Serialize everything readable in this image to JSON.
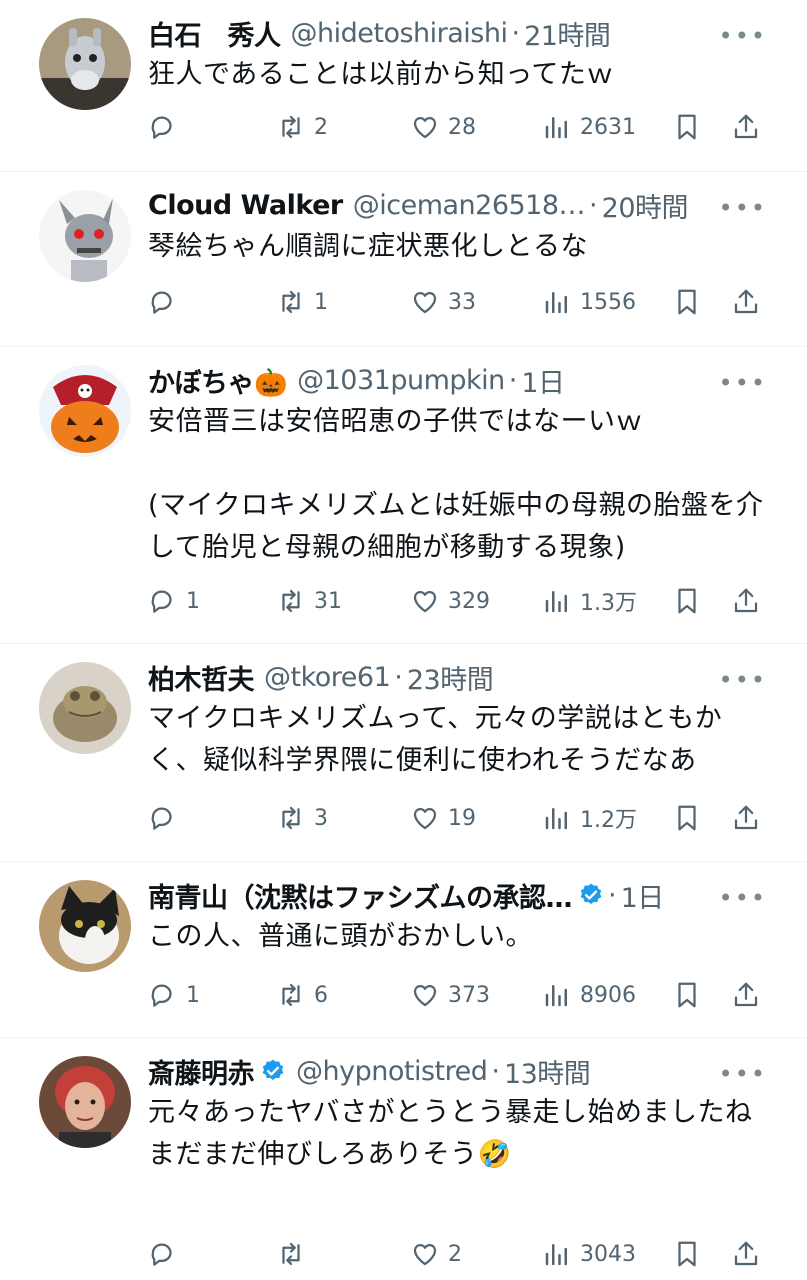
{
  "tweets": [
    {
      "name": "白石　秀人",
      "verified": false,
      "handle": "@hidetoshiraishi",
      "time": "21時間",
      "text": "狂人であることは以前から知ってたｗ",
      "replies": "",
      "retweets": "2",
      "likes": "28",
      "views": "2631",
      "avatar_icon": "donkey-robot-avatar"
    },
    {
      "name": "Cloud Walker",
      "verified": false,
      "handle": "@iceman26518…",
      "time": "20時間",
      "text": "琴絵ちゃん順調に症状悪化しとるな",
      "replies": "",
      "retweets": "1",
      "likes": "33",
      "views": "1556",
      "avatar_icon": "robot-avatar"
    },
    {
      "name": "かぼちゃ🎃",
      "verified": false,
      "handle": "@1031pumpkin",
      "time": "1日",
      "text": "安倍晋三は安倍昭恵の子供ではなーいｗ\n\n(マイクロキメリズムとは妊娠中の母親の胎盤を介して胎児と母親の細胞が移動する現象)",
      "replies": "1",
      "retweets": "31",
      "likes": "329",
      "views": "1.3万",
      "avatar_icon": "pirate-pumpkin-avatar"
    },
    {
      "name": "柏木哲夫",
      "verified": false,
      "handle": "@tkore61",
      "time": "23時間",
      "text": "マイクロキメリズムって、元々の学説はともかく、疑似科学界隈に便利に使われそうだなあ",
      "replies": "",
      "retweets": "3",
      "likes": "19",
      "views": "1.2万",
      "avatar_icon": "frog-statue-avatar"
    },
    {
      "name": "南青山（沈黙はファシズムの承認…",
      "verified": true,
      "handle": "",
      "time": "1日",
      "text": "この人、普通に頭がおかしい。",
      "replies": "1",
      "retweets": "6",
      "likes": "373",
      "views": "8906",
      "avatar_icon": "cat-avatar"
    },
    {
      "name": "斎藤明赤",
      "verified": true,
      "handle": "@hypnotistred",
      "time": "13時間",
      "text": "元々あったヤバさがとうとう暴走し始めましたね\nまだまだ伸びしろありそう🤣",
      "replies": "",
      "retweets": "",
      "likes": "2",
      "views": "3043",
      "avatar_icon": "person-photo-avatar"
    }
  ],
  "more_label": "•••",
  "separator": "·",
  "colors": {
    "verified": "#1d9bf0",
    "secondary": "#536471",
    "border": "#eff3f4"
  }
}
